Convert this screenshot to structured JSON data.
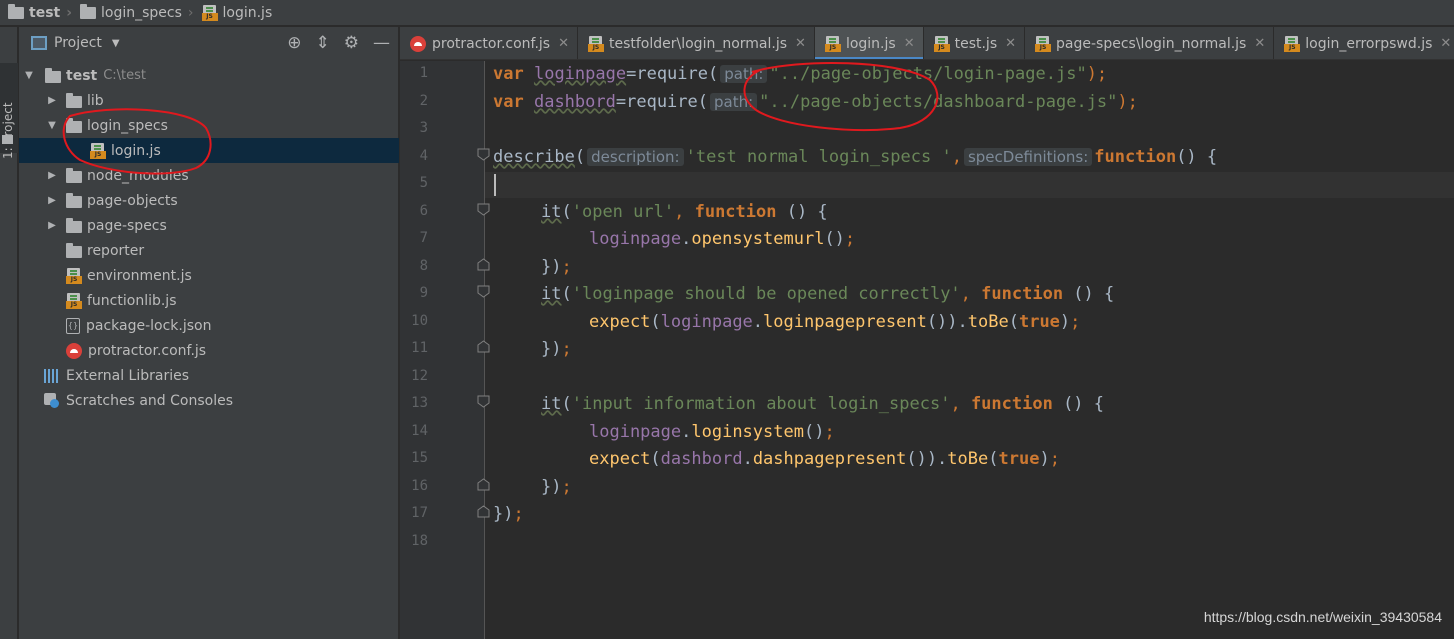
{
  "breadcrumb": [
    {
      "label": "test",
      "icon": "folder-icon"
    },
    {
      "label": "login_specs",
      "icon": "folder-icon"
    },
    {
      "label": "login.js",
      "icon": "js-file-icon"
    }
  ],
  "side_strip": {
    "tab_label": "1: Project"
  },
  "project_panel": {
    "title": "Project",
    "tools": [
      "locate-icon",
      "collapse-all-icon",
      "settings-icon",
      "hide-icon"
    ],
    "root": {
      "name": "test",
      "path": "C:\\test"
    },
    "items": [
      {
        "name": "lib",
        "type": "folder",
        "expandable": true
      },
      {
        "name": "login_specs",
        "type": "folder",
        "expanded": true
      },
      {
        "name": "login.js",
        "type": "js",
        "selected": true
      },
      {
        "name": "node_modules",
        "type": "folder",
        "expandable": true
      },
      {
        "name": "page-objects",
        "type": "folder",
        "expandable": true
      },
      {
        "name": "page-specs",
        "type": "folder",
        "expandable": true
      },
      {
        "name": "reporter",
        "type": "folder"
      },
      {
        "name": "environment.js",
        "type": "js"
      },
      {
        "name": "functionlib.js",
        "type": "js"
      },
      {
        "name": "package-lock.json",
        "type": "json"
      },
      {
        "name": "protractor.conf.js",
        "type": "protractor"
      },
      {
        "name": "External Libraries",
        "type": "libraries"
      },
      {
        "name": "Scratches and Consoles",
        "type": "scratches"
      }
    ]
  },
  "tabs": [
    {
      "label": "protractor.conf.js",
      "icon": "protractor-icon",
      "active": false
    },
    {
      "label": "testfolder\\login_normal.js",
      "icon": "js-file-icon",
      "active": false
    },
    {
      "label": "login.js",
      "icon": "js-file-icon",
      "active": true
    },
    {
      "label": "test.js",
      "icon": "js-file-icon",
      "active": false
    },
    {
      "label": "page-specs\\login_normal.js",
      "icon": "js-file-icon",
      "active": false
    },
    {
      "label": "login_errorpswd.js",
      "icon": "js-file-icon",
      "active": false
    }
  ],
  "editor": {
    "line_numbers": [
      "1",
      "2",
      "3",
      "4",
      "5",
      "6",
      "7",
      "8",
      "9",
      "10",
      "11",
      "12",
      "13",
      "14",
      "15",
      "16",
      "17",
      "18"
    ],
    "code": {
      "l1": {
        "kw": "var",
        "name": "loginpage",
        "eq": "=",
        "call": "require",
        "open": "(",
        "hint": "path:",
        "str": "\"../page-objects/login-page.js\"",
        "close": ");"
      },
      "l2": {
        "kw": "var",
        "name": "dashbord",
        "eq": "=",
        "call": "require",
        "open": "(",
        "hint": "path:",
        "str": "\"../page-objects/dashboard-page.js\"",
        "close": ");"
      },
      "l4": {
        "call": "describe",
        "open": "(",
        "hint1": "description:",
        "str": "'test normal login_specs '",
        "comma": ",",
        "hint2": "specDefinitions:",
        "kw": "function",
        "tail": "() {"
      },
      "l6": {
        "call": "it",
        "open": "(",
        "str": "'open url'",
        "comma": ",",
        "kw": "function",
        "tail": " () {"
      },
      "l7": {
        "obj": "loginpage",
        "dot": ".",
        "method": "opensystemurl",
        "tail": "()",
        "semi": ";"
      },
      "l8": {
        "text": "})",
        "semi": ";"
      },
      "l9": {
        "call": "it",
        "open": "(",
        "str": "'loginpage should be opened correctly'",
        "comma": ",",
        "kw": "function",
        "tail": " () {"
      },
      "l10": {
        "call": "expect",
        "open": "(",
        "obj": "loginpage",
        "dot": ".",
        "method": "loginpagepresent",
        "mid": "()).",
        "method2": "toBe",
        "open2": "(",
        "kw": "true",
        "close": ")",
        "semi": ";"
      },
      "l11": {
        "text": "})",
        "semi": ";"
      },
      "l13": {
        "call": "it",
        "open": "(",
        "str": "'input information about login_specs'",
        "comma": ",",
        "kw": "function",
        "tail": " () {"
      },
      "l14": {
        "obj": "loginpage",
        "dot": ".",
        "method": "loginsystem",
        "tail": "()",
        "semi": ";"
      },
      "l15": {
        "call": "expect",
        "open": "(",
        "obj": "dashbord",
        "dot": ".",
        "method": "dashpagepresent",
        "mid": "()).",
        "method2": "toBe",
        "open2": "(",
        "kw": "true",
        "close": ")",
        "semi": ";"
      },
      "l16": {
        "text": "})",
        "semi": ";"
      },
      "l17": {
        "text": "})",
        "semi": ";"
      }
    }
  },
  "watermark": "https://blog.csdn.net/weixin_39430584",
  "colors": {
    "keyword": "#cc7832",
    "string": "#6a8759",
    "variable": "#9876aa",
    "function": "#ffc66d",
    "annotation": "#e0191e",
    "active_tab_underline": "#4a88c7"
  }
}
